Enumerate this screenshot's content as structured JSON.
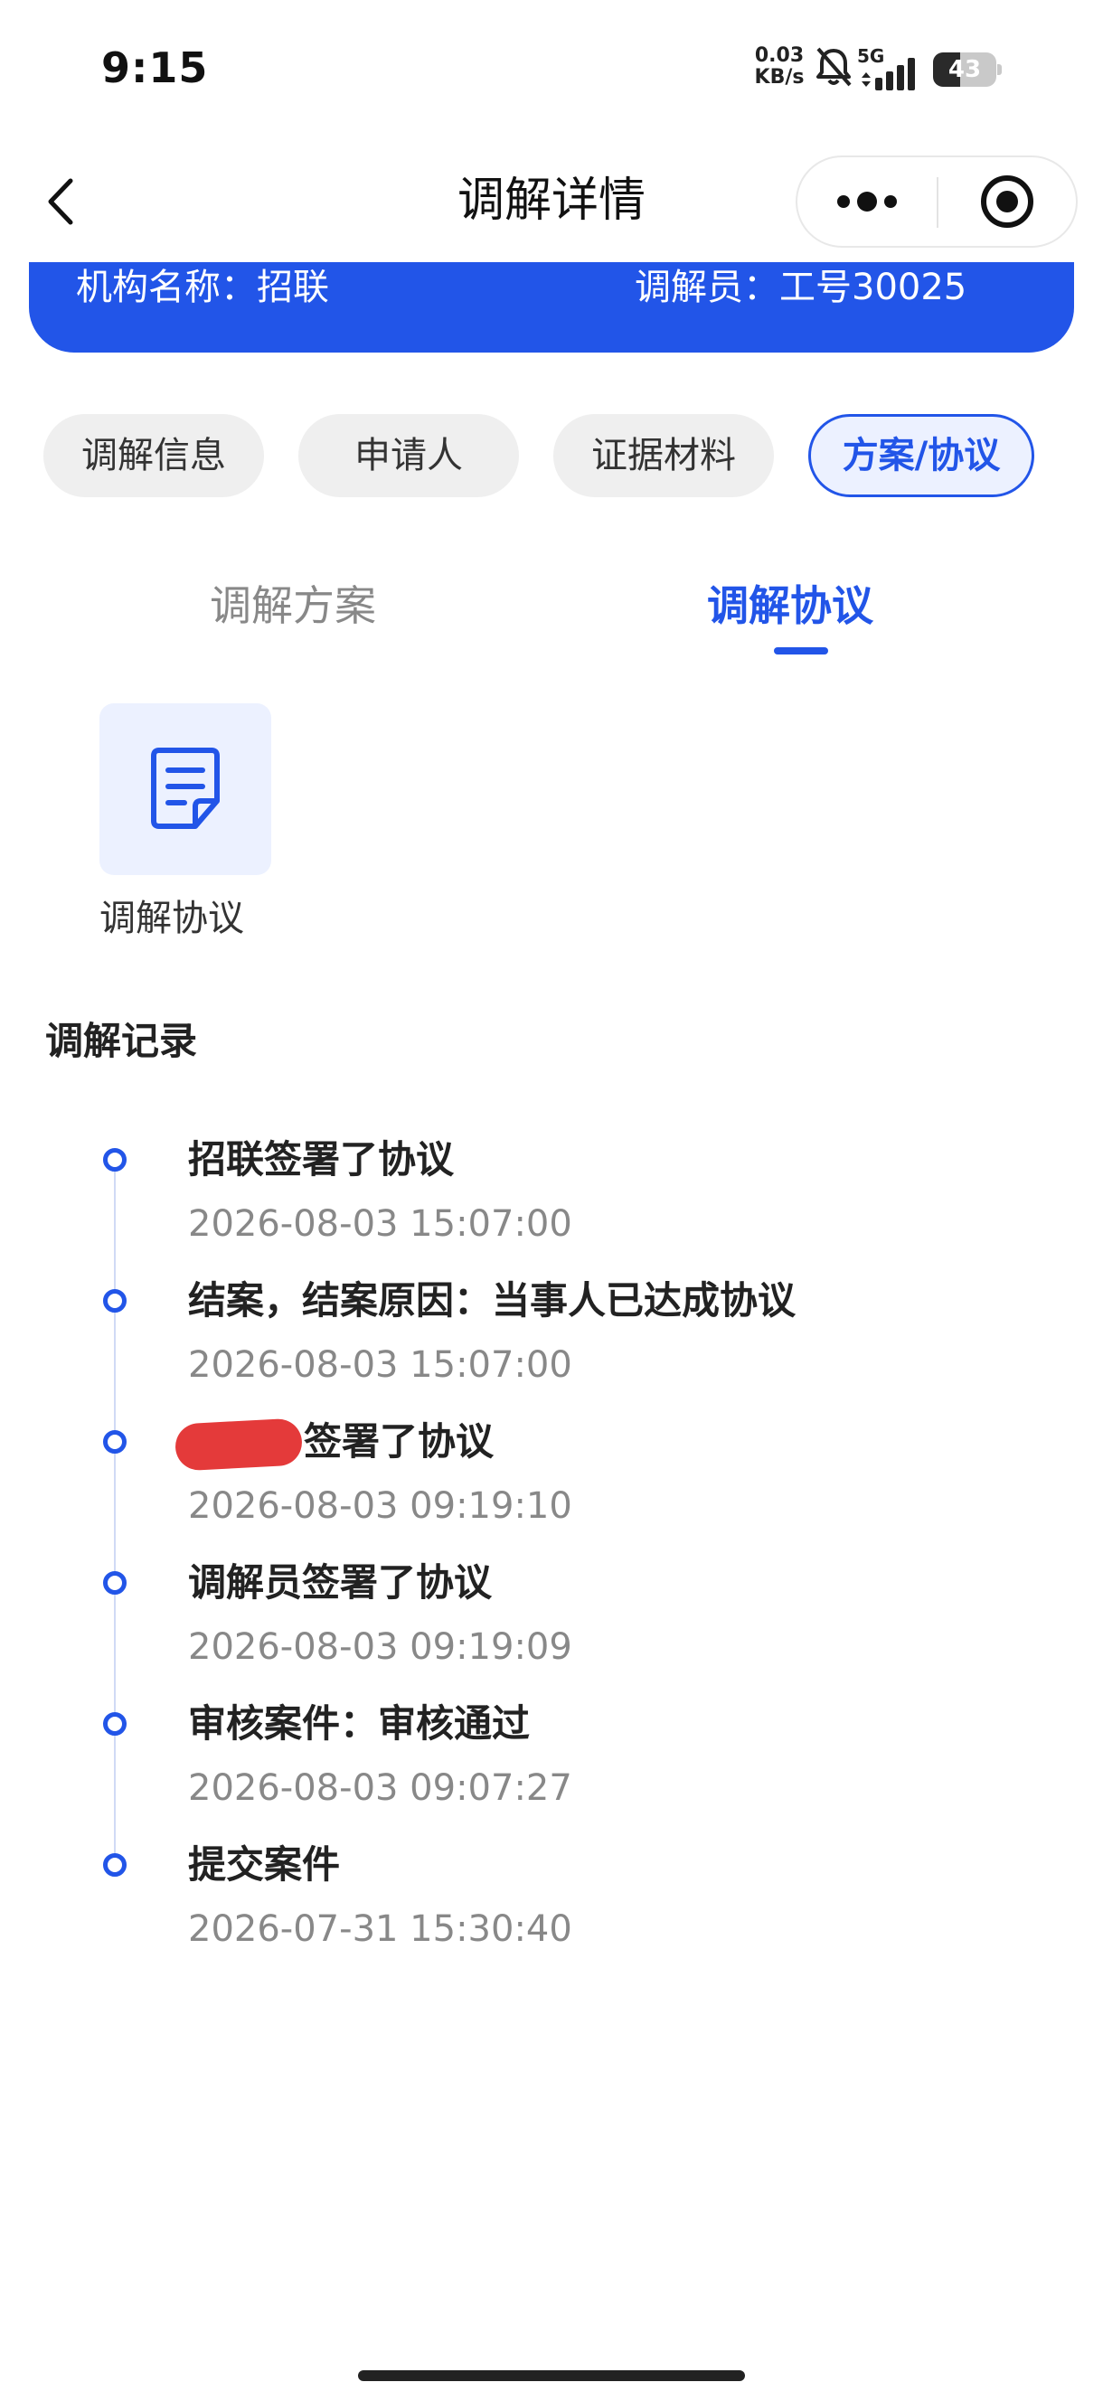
{
  "status_bar": {
    "time": "9:15",
    "network_speed_value": "0.03",
    "network_speed_unit": "KB/s",
    "network_type": "5G",
    "battery_percent": "43",
    "battery_level": 0.43,
    "icons": [
      "bell-off-icon",
      "signal-icon",
      "battery-icon"
    ]
  },
  "nav": {
    "title": "调解详情",
    "back_icon": "chevron-left-icon",
    "more_icon": "more-dots-icon",
    "close_icon": "target-circle-icon"
  },
  "info_card": {
    "org": "机构名称：招联",
    "mediator": "调解员：工号30025"
  },
  "chips": [
    {
      "label": "调解信息",
      "active": false
    },
    {
      "label": "申请人",
      "active": false
    },
    {
      "label": "证据材料",
      "active": false
    },
    {
      "label": "方案/协议",
      "active": true
    }
  ],
  "sub_tabs": [
    {
      "label": "调解方案",
      "active": false
    },
    {
      "label": "调解协议",
      "active": true
    }
  ],
  "document": {
    "label": "调解协议",
    "icon": "document-icon"
  },
  "records": {
    "title": "调解记录",
    "items": [
      {
        "title": "招联签署了协议",
        "time": "2026-08-03 15:07:00"
      },
      {
        "title": "结案，结案原因：当事人已达成协议",
        "time": "2026-08-03 15:07:00"
      },
      {
        "title": "签署了协议",
        "time": "2026-08-03 09:19:10",
        "redacted_prefix": true
      },
      {
        "title": "调解员签署了协议",
        "time": "2026-08-03 09:19:09"
      },
      {
        "title": "审核案件：审核通过",
        "time": "2026-08-03 09:07:27"
      },
      {
        "title": "提交案件",
        "time": "2026-07-31 15:30:40"
      }
    ]
  },
  "colors": {
    "accent": "#2255e8",
    "chip_bg": "#efefef",
    "active_chip_bg": "#ecf1ff",
    "muted_text": "#888888",
    "redaction": "#e43a3a"
  }
}
